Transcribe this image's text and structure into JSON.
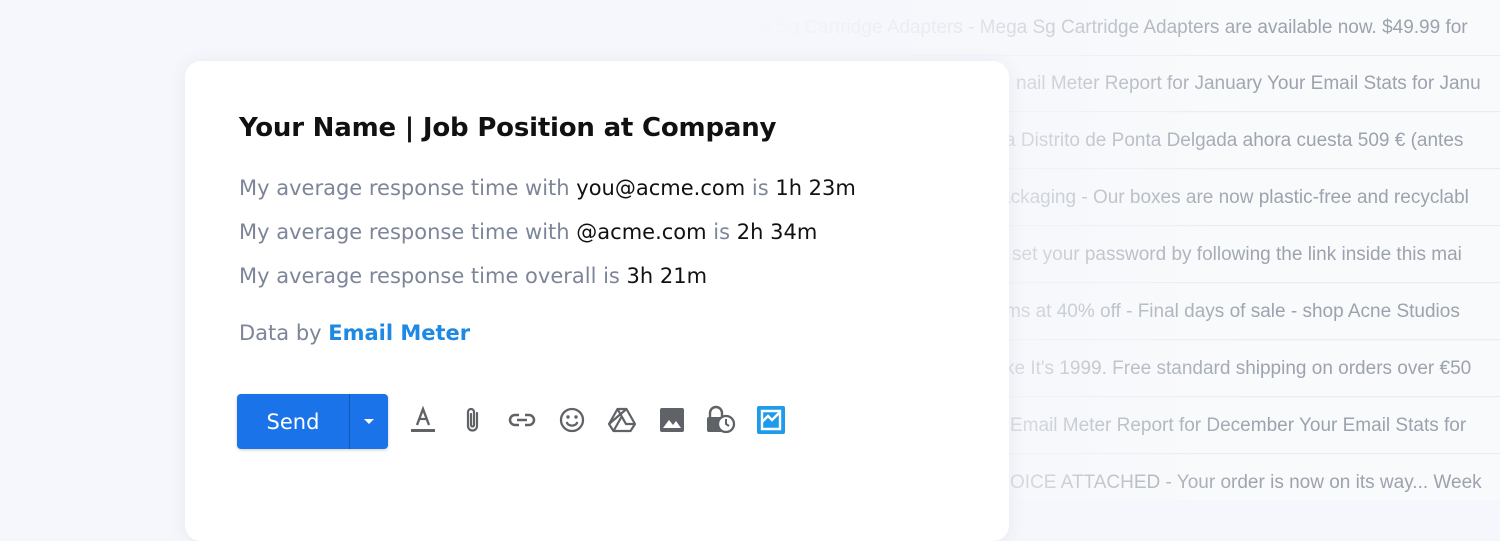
{
  "inbox": {
    "rows": [
      "a Sg Cartridge Adapters - Mega Sg Cartridge Adapters are available now. $49.99 for",
      "nail Meter Report for January Your Email Stats for Janu",
      "a Distrito de Ponta Delgada ahora cuesta 509 € (antes",
      "ackaging - Our boxes are now plastic-free and recyclabl",
      "set your password by following the link inside this mai",
      "ms at 40% off - Final days of sale - shop Acne Studios",
      "ke It's 1999. Free standard shipping on orders over €50",
      "Email Meter Report for December Your Email Stats for",
      "OICE ATTACHED - Your order is now on its way... Week"
    ]
  },
  "signature": {
    "name": "Your Name | Job Position at Company",
    "line1": {
      "prefix": "My average response time with ",
      "email": "you@acme.com",
      "mid": " is ",
      "value": "1h 23m"
    },
    "line2": {
      "prefix": "My average response time with ",
      "email": "@acme.com",
      "mid": " is ",
      "value": "2h 34m"
    },
    "line3": {
      "prefix": "My average response time overall is ",
      "value": "3h 21m"
    },
    "credit": {
      "prefix": "Data by ",
      "link": "Email Meter"
    }
  },
  "toolbar": {
    "send_label": "Send",
    "icons": [
      "more-send-options-icon",
      "format-text-icon",
      "attach-file-icon",
      "insert-link-icon",
      "insert-emoji-icon",
      "google-drive-icon",
      "insert-photo-icon",
      "confidential-mode-icon",
      "email-meter-icon"
    ],
    "accent_color": "#1a73e8",
    "email_meter_color": "#1e9be9"
  }
}
